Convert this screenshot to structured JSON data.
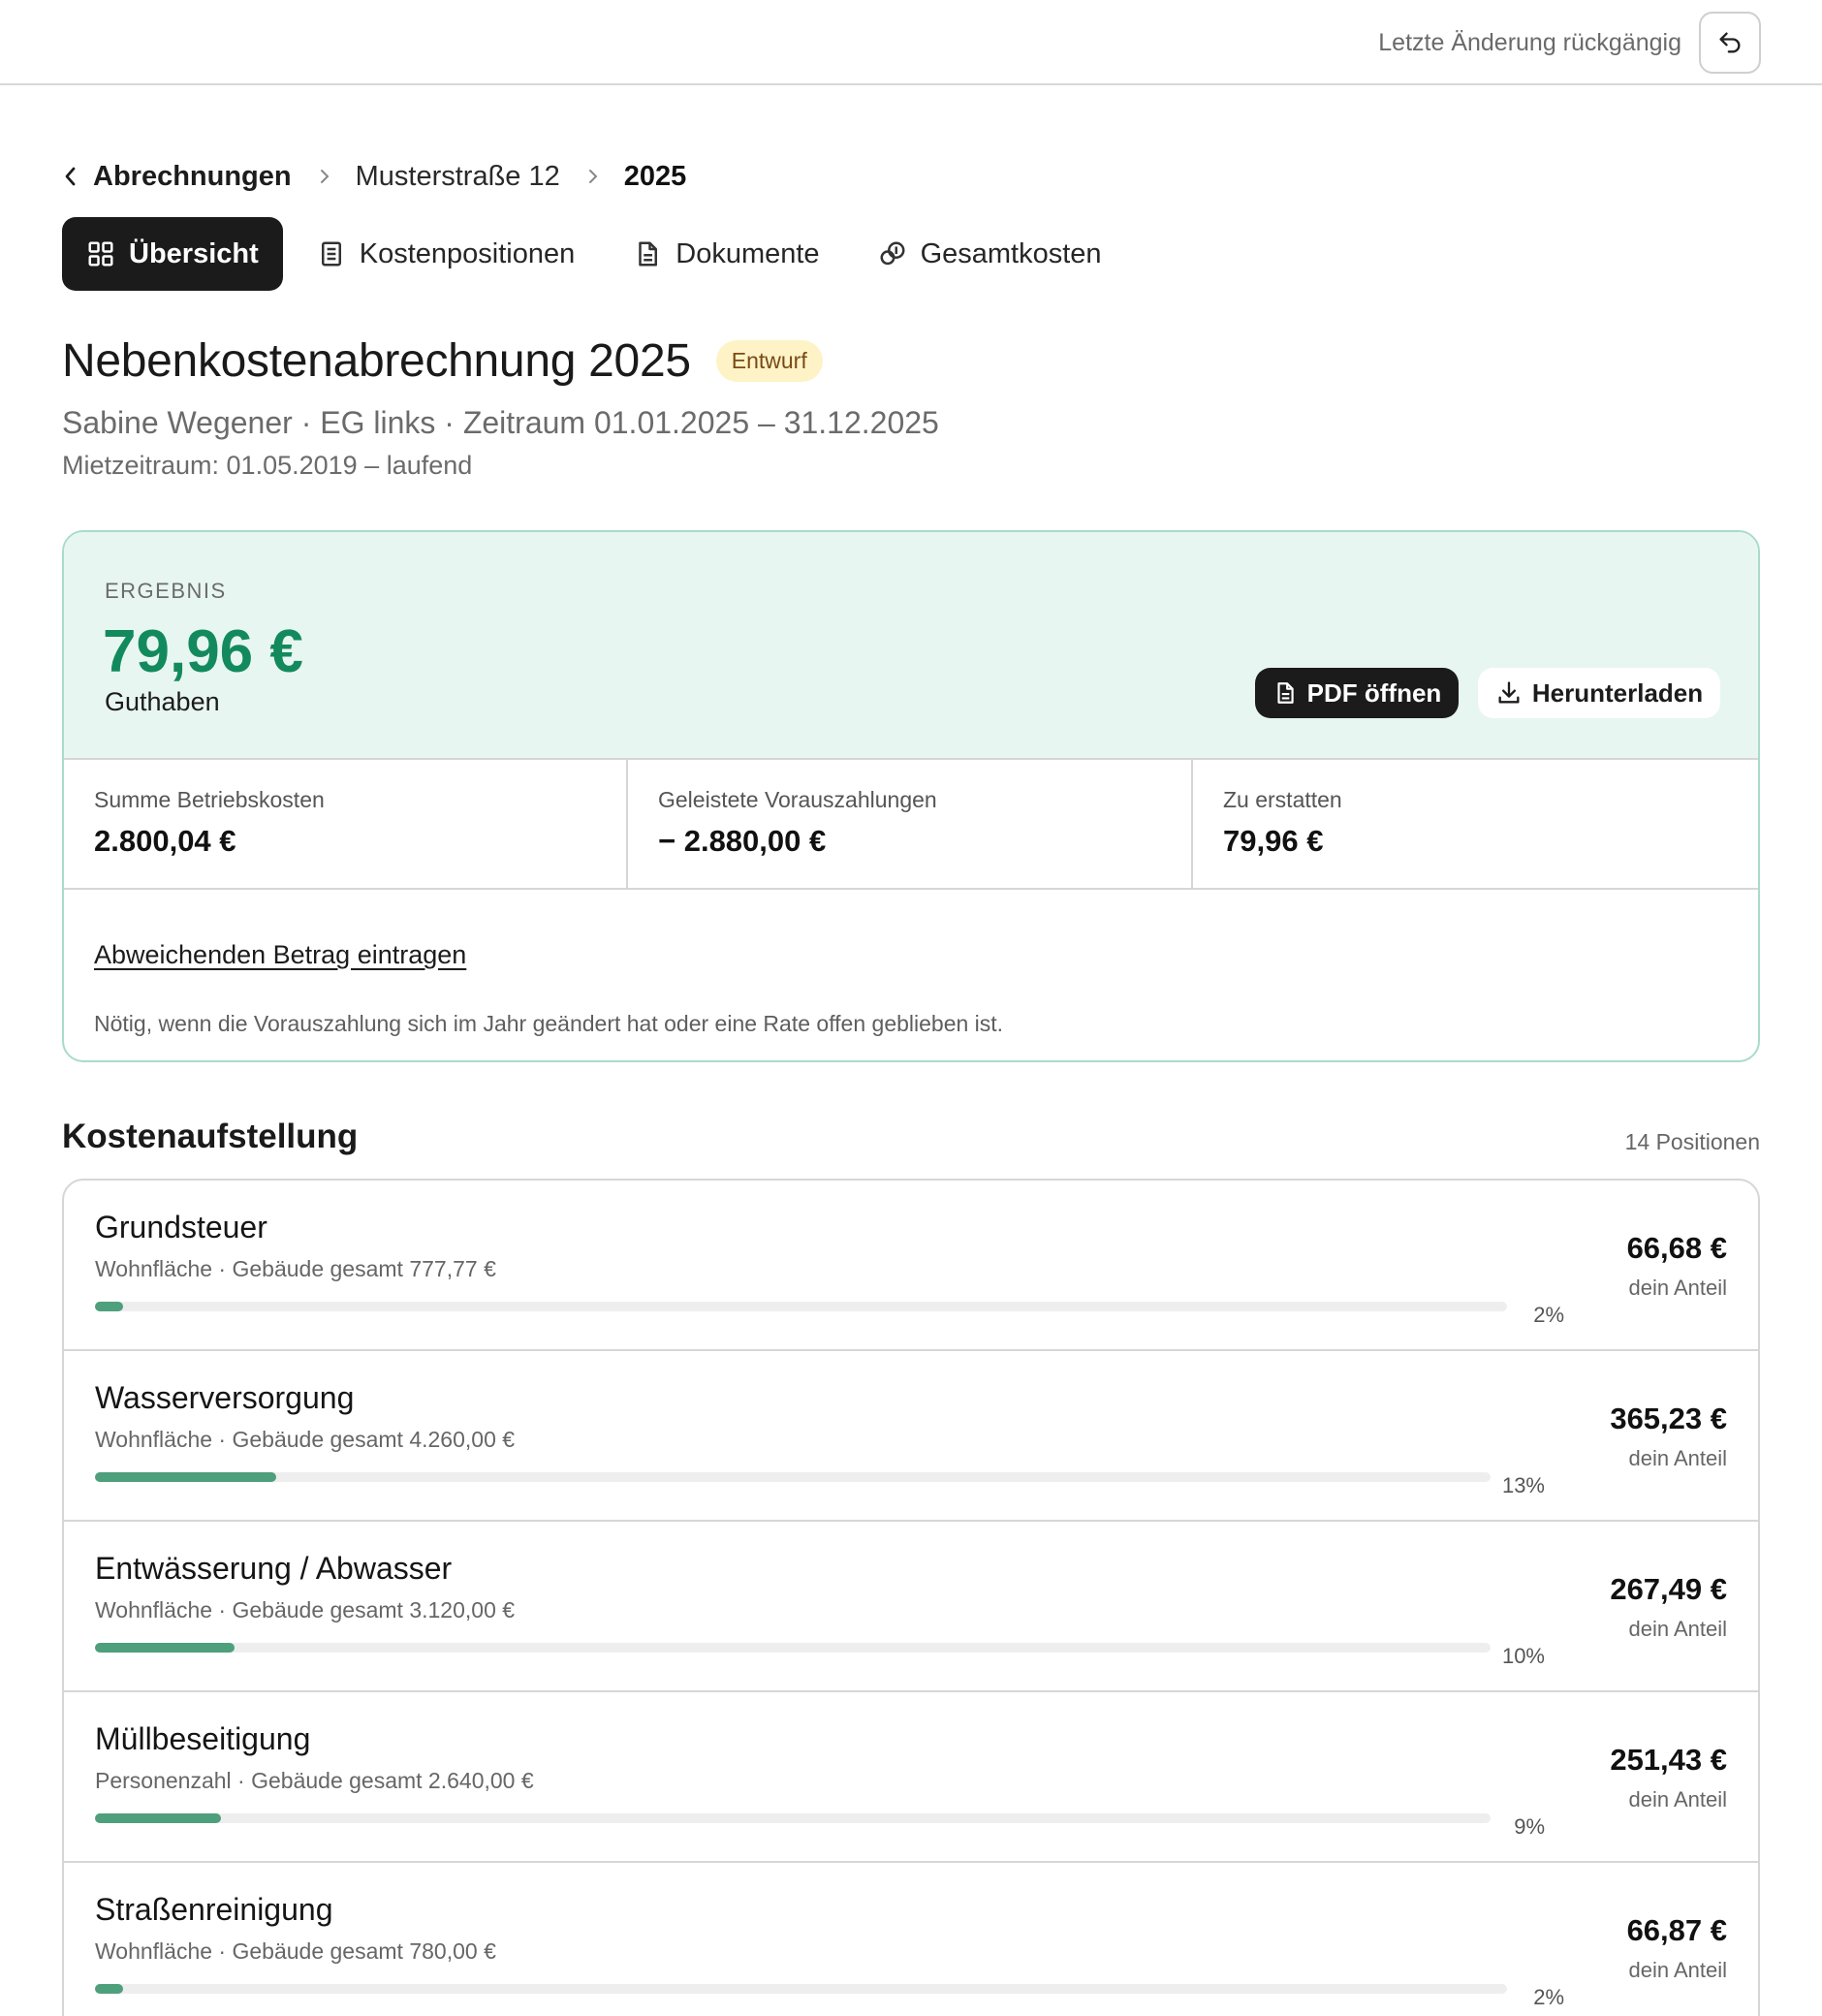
{
  "header": {
    "undo_label": "Letzte Änderung rückgängig",
    "undo_icon": "undo-icon"
  },
  "breadcrumb": {
    "back_label": "Abrechnungen",
    "property": "Musterstraße 12",
    "current": "2025"
  },
  "tabs": [
    {
      "label": "Übersicht",
      "icon": "grid-icon",
      "active": true
    },
    {
      "label": "Kostenpositionen",
      "icon": "list-icon",
      "active": false
    },
    {
      "label": "Dokumente",
      "icon": "document-icon",
      "active": false
    },
    {
      "label": "Gesamtkosten",
      "icon": "coins-icon",
      "active": false
    }
  ],
  "page": {
    "title": "Nebenkostenabrechnung 2025",
    "status_badge": "Entwurf",
    "subtitle": "Sabine Wegener · EG links · Zeitraum 01.01.2025 – 31.12.2025",
    "tenancy": "Mietzeitraum: 01.05.2019 – laufend"
  },
  "result": {
    "label": "ERGEBNIS",
    "amount": "79,96 €",
    "type": "Guthaben",
    "pdf_button": "PDF öffnen",
    "download_button": "Herunterladen",
    "accent_color": "#138a5d",
    "stats": [
      {
        "label": "Summe Betriebskosten",
        "value": "2.800,04 €"
      },
      {
        "label": "Geleistete Vorauszahlungen",
        "value": "− 2.880,00 €"
      },
      {
        "label": "Zu erstatten",
        "value": "79,96 €"
      }
    ],
    "adjust_link": "Abweichenden Betrag eintragen",
    "adjust_note": "Nötig, wenn die Vorauszahlung sich im Jahr geändert hat oder eine Rate offen geblieben ist."
  },
  "costs": {
    "title": "Kostenaufstellung",
    "count": "14 Positionen",
    "share_label": "dein Anteil",
    "bar_color": "#4e9f7c",
    "items": [
      {
        "name": "Grundsteuer",
        "meta": "Wohnfläche · Gebäude gesamt 777,77 €",
        "percent": 2,
        "percent_label": "2%",
        "amount": "66,68 €"
      },
      {
        "name": "Wasserversorgung",
        "meta": "Wohnfläche · Gebäude gesamt 4.260,00 €",
        "percent": 13,
        "percent_label": "13%",
        "amount": "365,23 €"
      },
      {
        "name": "Entwässerung / Abwasser",
        "meta": "Wohnfläche · Gebäude gesamt 3.120,00 €",
        "percent": 10,
        "percent_label": "10%",
        "amount": "267,49 €"
      },
      {
        "name": "Müllbeseitigung",
        "meta": "Personenzahl · Gebäude gesamt 2.640,00 €",
        "percent": 9,
        "percent_label": "9%",
        "amount": "251,43 €"
      },
      {
        "name": "Straßenreinigung",
        "meta": "Wohnfläche · Gebäude gesamt 780,00 €",
        "percent": 2,
        "percent_label": "2%",
        "amount": "66,87 €"
      }
    ]
  }
}
